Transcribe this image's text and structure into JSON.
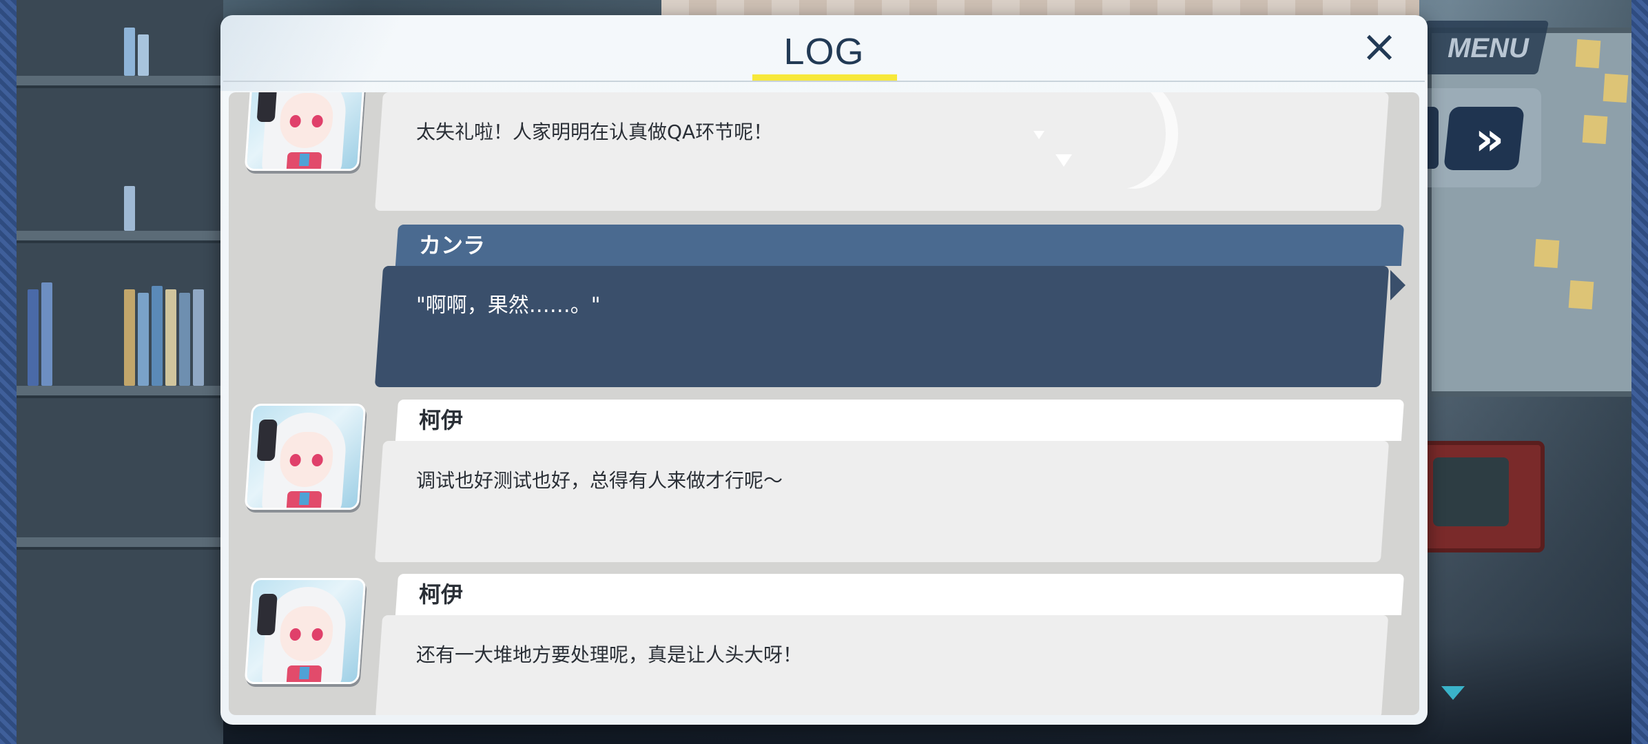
{
  "hud": {
    "menu_label": "MENU",
    "skip_icon": "fast-forward-icon"
  },
  "log": {
    "title": "LOG",
    "close_icon": "×",
    "entries": [
      {
        "speaker": "",
        "text": "太失礼啦！人家明明在认真做QA环节呢！",
        "portrait": "koi-portrait"
      },
      {
        "speaker": "カンラ",
        "text": "\"啊啊，果然……。\"",
        "portrait": ""
      },
      {
        "speaker": "柯伊",
        "text": "调试也好测试也好，总得有人来做才行呢～",
        "portrait": "koi-portrait"
      },
      {
        "speaker": "柯伊",
        "text": "还有一大堆地方要处理呢，真是让人头大呀！",
        "portrait": "koi-portrait"
      }
    ]
  },
  "colors": {
    "accent_yellow": "#f7e83a",
    "player_bubble": "#3a4f6b",
    "player_nameplate": "#4a6a90",
    "npc_bubble": "#eeeeee",
    "title_text": "#223a55"
  }
}
